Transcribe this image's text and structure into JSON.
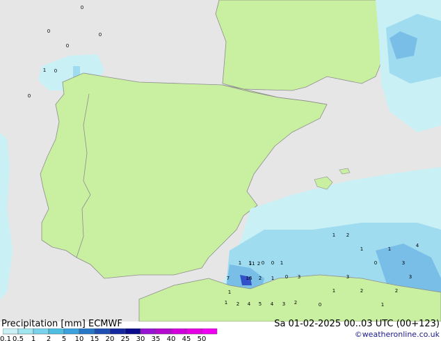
{
  "footer": {
    "title_left": "Precipitation [mm]  ECMWF",
    "title_right": "Sa 01-02-2025 00..03 UTC (00+123)",
    "credit": "©weatheronline.co.uk"
  },
  "legend": {
    "ticks": [
      "0.1",
      "0.5",
      "1",
      "2",
      "5",
      "10",
      "15",
      "20",
      "25",
      "30",
      "35",
      "40",
      "45",
      "50"
    ],
    "colors": [
      "#c8f0f5",
      "#a0e6f0",
      "#78d2eb",
      "#50bee1",
      "#3ca0dc",
      "#2878c8",
      "#1e50b4",
      "#1428a0",
      "#0a0a8c",
      "#9614d2",
      "#b40ad2",
      "#d200dc",
      "#e600e6",
      "#f000f0"
    ]
  },
  "map": {
    "land_color": "#c8f0a0",
    "sea_color": "#e6e6e6",
    "border_color": "#8c8c8c",
    "light_precip_color": "#c8f0f5",
    "mid_precip_color": "#a0dcf0",
    "heavy_precip_color": "#78bee6",
    "max_precip_color": "#3250c8",
    "values": [
      {
        "v": "0"
      },
      {
        "v": "0"
      },
      {
        "v": "0"
      },
      {
        "v": "0"
      },
      {
        "v": "1"
      },
      {
        "v": "0"
      },
      {
        "v": "0"
      },
      {
        "v": "1"
      },
      {
        "v": "2"
      },
      {
        "v": "4"
      },
      {
        "v": "5"
      },
      {
        "v": "4"
      },
      {
        "v": "3"
      },
      {
        "v": "2"
      },
      {
        "v": "1"
      },
      {
        "v": "1"
      },
      {
        "v": "0"
      },
      {
        "v": "0"
      },
      {
        "v": "1"
      },
      {
        "v": "11"
      },
      {
        "v": "2"
      },
      {
        "v": "7"
      },
      {
        "v": "16"
      },
      {
        "v": "2"
      },
      {
        "v": "1"
      },
      {
        "v": "0"
      },
      {
        "v": "3"
      },
      {
        "v": "1"
      },
      {
        "v": "1"
      },
      {
        "v": "2"
      },
      {
        "v": "1"
      },
      {
        "v": "0"
      },
      {
        "v": "1"
      },
      {
        "v": "3"
      },
      {
        "v": "4"
      },
      {
        "v": "3"
      },
      {
        "v": "2"
      },
      {
        "v": "1"
      },
      {
        "v": "2"
      },
      {
        "v": "3"
      },
      {
        "v": "1"
      },
      {
        "v": "0"
      }
    ]
  }
}
